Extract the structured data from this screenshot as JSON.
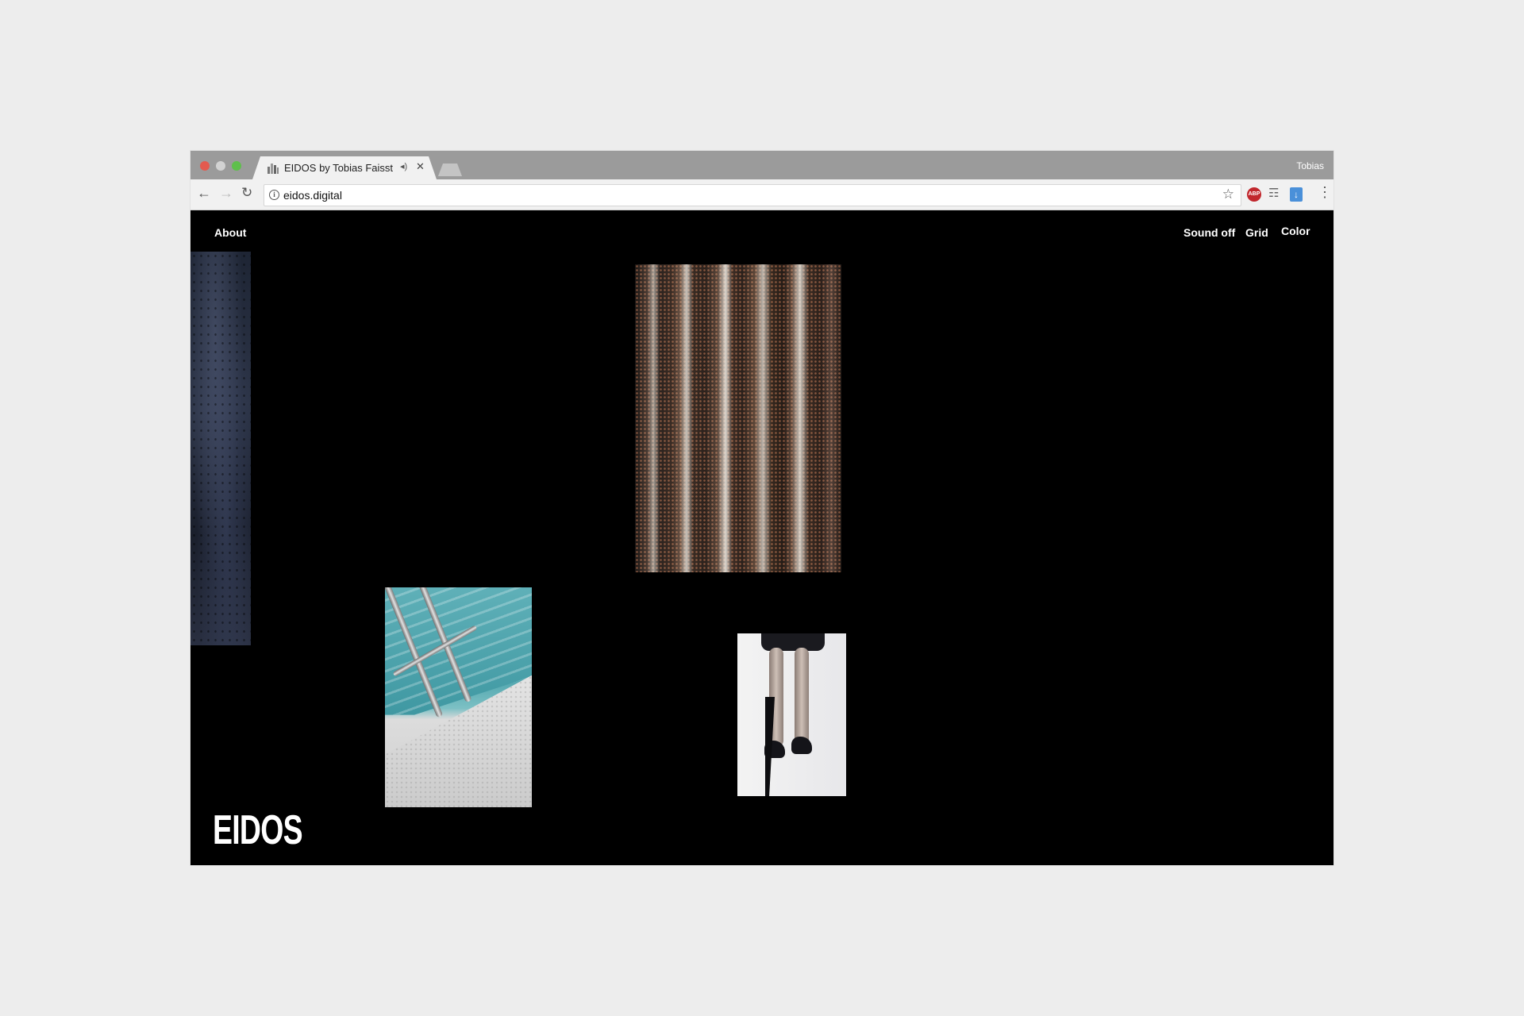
{
  "window": {
    "tab_title": "EIDOS by Tobias Faisst",
    "profile_name": "Tobias"
  },
  "toolbar": {
    "url": "eidos.digital"
  },
  "page": {
    "nav_left": {
      "about": "About"
    },
    "nav_right": {
      "sound": "Sound off",
      "grid": "Grid",
      "color": "Color"
    },
    "logo": "EIDOS"
  },
  "icons": {
    "back": "arrow-left-icon",
    "forward": "arrow-right-icon",
    "reload": "reload-icon",
    "info": "info-icon",
    "star": "star-icon",
    "adblock": "adblock-icon",
    "extension": "puzzle-icon",
    "download": "download-icon",
    "menu": "kebab-menu-icon",
    "mute": "speaker-icon",
    "close": "close-icon"
  },
  "colors": {
    "page_background": "#000000",
    "outer_background": "#ededed",
    "tabstrip": "#9b9b9b",
    "text": "#ffffff"
  }
}
